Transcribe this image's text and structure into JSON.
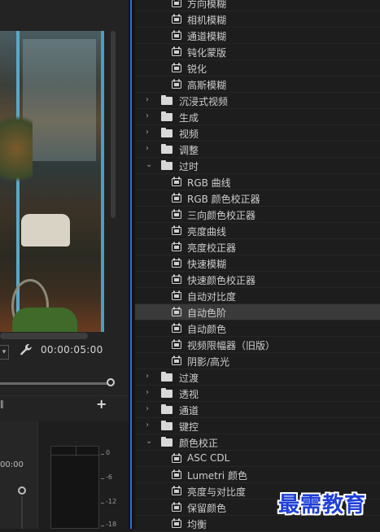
{
  "left_panel": {
    "timecode": "00:00:05:00",
    "timecode_partial": "00:00",
    "add_button": "+",
    "meter_ticks": [
      "0",
      "-6",
      "-12",
      "-18"
    ]
  },
  "effects_tree": {
    "items": [
      {
        "type": "effect",
        "level": 2,
        "label": "方向模糊"
      },
      {
        "type": "effect",
        "level": 2,
        "label": "相机模糊"
      },
      {
        "type": "effect",
        "level": 2,
        "label": "通道模糊"
      },
      {
        "type": "effect",
        "level": 2,
        "label": "钝化蒙版"
      },
      {
        "type": "effect",
        "level": 2,
        "label": "锐化"
      },
      {
        "type": "effect",
        "level": 2,
        "label": "高斯模糊"
      },
      {
        "type": "folder",
        "expanded": false,
        "label": "沉浸式视频"
      },
      {
        "type": "folder",
        "expanded": false,
        "label": "生成"
      },
      {
        "type": "folder",
        "expanded": false,
        "label": "视频"
      },
      {
        "type": "folder",
        "expanded": false,
        "label": "调整"
      },
      {
        "type": "folder",
        "expanded": true,
        "label": "过时"
      },
      {
        "type": "effect",
        "level": 2,
        "label": "RGB 曲线"
      },
      {
        "type": "effect",
        "level": 2,
        "label": "RGB 颜色校正器"
      },
      {
        "type": "effect",
        "level": 2,
        "label": "三向颜色校正器"
      },
      {
        "type": "effect",
        "level": 2,
        "label": "亮度曲线"
      },
      {
        "type": "effect",
        "level": 2,
        "label": "亮度校正器"
      },
      {
        "type": "effect",
        "level": 2,
        "label": "快速模糊"
      },
      {
        "type": "effect",
        "level": 2,
        "label": "快速颜色校正器"
      },
      {
        "type": "effect",
        "level": 2,
        "label": "自动对比度"
      },
      {
        "type": "effect",
        "level": 2,
        "label": "自动色阶",
        "selected": true
      },
      {
        "type": "effect",
        "level": 2,
        "label": "自动颜色"
      },
      {
        "type": "effect",
        "level": 2,
        "label": "视频限幅器（旧版）"
      },
      {
        "type": "effect",
        "level": 2,
        "label": "阴影/高光"
      },
      {
        "type": "folder",
        "expanded": false,
        "label": "过渡"
      },
      {
        "type": "folder",
        "expanded": false,
        "label": "透视"
      },
      {
        "type": "folder",
        "expanded": false,
        "label": "通道"
      },
      {
        "type": "folder",
        "expanded": false,
        "label": "键控"
      },
      {
        "type": "folder",
        "expanded": true,
        "label": "颜色校正"
      },
      {
        "type": "effect",
        "level": 2,
        "label": "ASC CDL"
      },
      {
        "type": "effect",
        "level": 2,
        "label": "Lumetri 颜色"
      },
      {
        "type": "effect",
        "level": 2,
        "label": "亮度与对比度"
      },
      {
        "type": "effect",
        "level": 2,
        "label": "保留颜色"
      },
      {
        "type": "effect",
        "level": 2,
        "label": "均衡"
      }
    ]
  },
  "watermark": "最需教育",
  "colors": {
    "accent_blue": "#2d6bd8",
    "selected_row": "#3a3a3a",
    "watermark": "#1f3fd6"
  }
}
